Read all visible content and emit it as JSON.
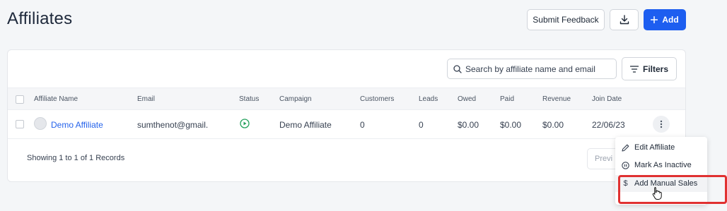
{
  "page": {
    "title": "Affiliates"
  },
  "header_actions": {
    "submit_feedback": "Submit Feedback",
    "add": "Add"
  },
  "search": {
    "placeholder": "Search by affiliate name and email"
  },
  "filters": {
    "label": "Filters"
  },
  "table": {
    "columns": [
      "Affiliate Name",
      "Email",
      "Status",
      "Campaign",
      "Customers",
      "Leads",
      "Owed",
      "Paid",
      "Revenue",
      "Join Date"
    ],
    "rows": [
      {
        "name": "Demo Affiliate",
        "email": "sumthenot@gmail.",
        "status": "active",
        "campaign": "Demo Affiliate",
        "customers": "0",
        "leads": "0",
        "owed": "$0.00",
        "paid": "$0.00",
        "revenue": "$0.00",
        "join_date": "22/06/23"
      }
    ]
  },
  "footer": {
    "records": "Showing 1 to 1 of 1 Records",
    "prev": "Previ"
  },
  "context_menu": {
    "items": [
      "Edit Affiliate",
      "Mark As Inactive",
      "Add Manual Sales"
    ]
  },
  "colors": {
    "primary": "#1d5ef0",
    "link": "#2563eb",
    "status_active": "#22a05b",
    "highlight": "#e03131"
  }
}
